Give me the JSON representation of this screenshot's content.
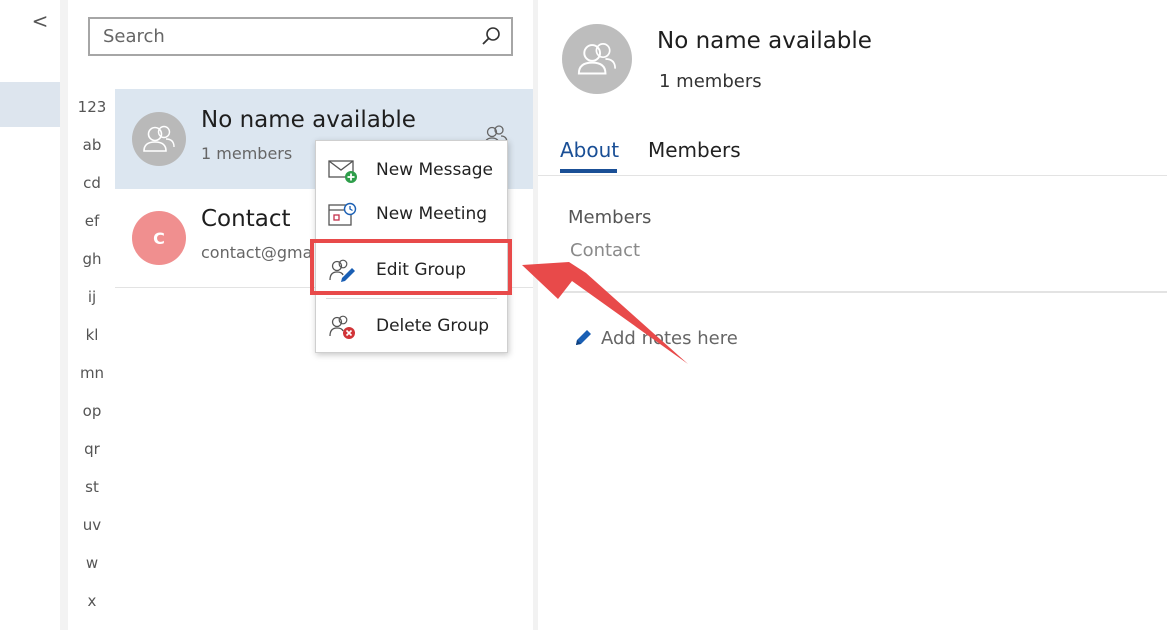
{
  "nav": {
    "back_glyph": "<"
  },
  "search": {
    "placeholder": "Search",
    "value": ""
  },
  "alphabet": [
    "123",
    "ab",
    "cd",
    "ef",
    "gh",
    "ij",
    "kl",
    "mn",
    "op",
    "qr",
    "st",
    "uv",
    "w",
    "x"
  ],
  "contacts": [
    {
      "name": "No name available",
      "subtitle": "1 members",
      "avatar": "group-icon",
      "selected": true
    },
    {
      "name": "Contact",
      "subtitle": "contact@gma",
      "avatar_letter": "C",
      "avatar_color": "#f08f8f",
      "selected": false
    }
  ],
  "context_menu": {
    "items": [
      {
        "label": "New Message",
        "icon": "new-message-icon"
      },
      {
        "label": "New Meeting",
        "icon": "new-meeting-icon"
      },
      {
        "label": "Edit Group",
        "icon": "edit-group-icon",
        "highlighted": true
      },
      {
        "label": "Delete Group",
        "icon": "delete-group-icon"
      }
    ]
  },
  "detail": {
    "name": "No name available",
    "member_count": "1 members",
    "tabs": [
      {
        "label": "About",
        "active": true
      },
      {
        "label": "Members",
        "active": false
      }
    ],
    "members_heading": "Members",
    "members_value": "Contact",
    "notes_placeholder": "Add notes here"
  },
  "colors": {
    "accent": "#1a4f96",
    "selected_row": "#dce6f0",
    "annotation_red": "#e84a4a",
    "contact_avatar": "#f08f8f"
  }
}
